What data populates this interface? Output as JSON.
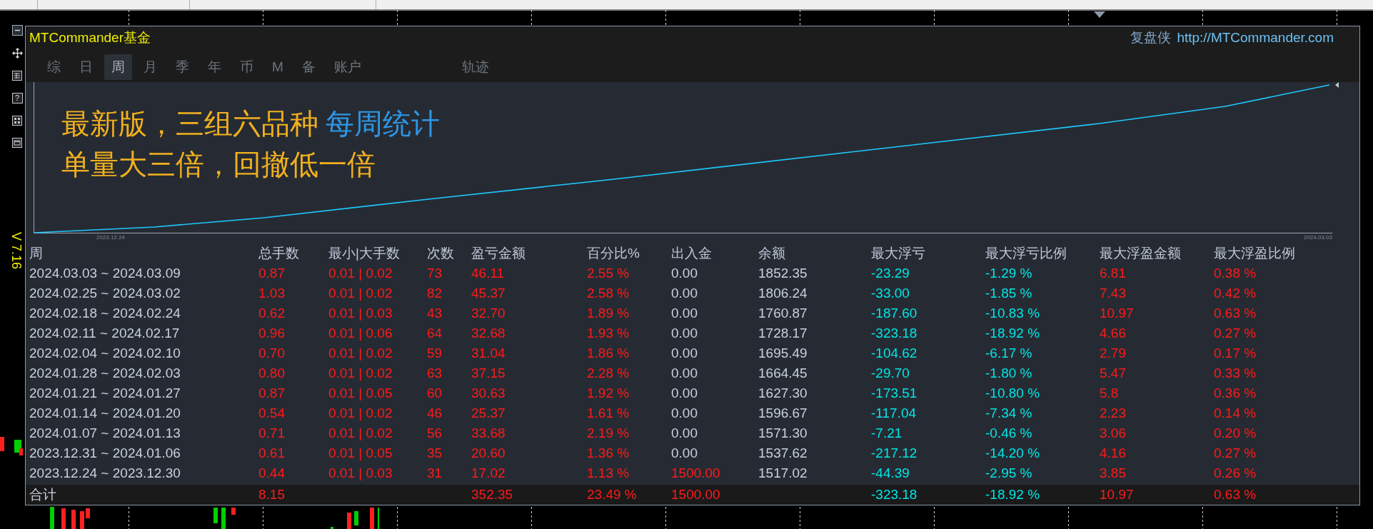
{
  "panel": {
    "title": "MTCommander基金",
    "brand": "复盘侠",
    "url": "http://MTCommander.com"
  },
  "side_toolbar": {
    "help": "?"
  },
  "version": "V 7.16",
  "tabs": [
    {
      "label": "综",
      "selected": false
    },
    {
      "label": "日",
      "selected": false
    },
    {
      "label": "周",
      "selected": true
    },
    {
      "label": "月",
      "selected": false
    },
    {
      "label": "季",
      "selected": false
    },
    {
      "label": "年",
      "selected": false
    },
    {
      "label": "币",
      "selected": false
    },
    {
      "label": "M",
      "selected": false
    },
    {
      "label": "备",
      "selected": false
    },
    {
      "label": "账户",
      "selected": false
    },
    {
      "label": "轨迹",
      "selected": false
    }
  ],
  "headline": {
    "line_1": "最新版，三组六品种",
    "tag": "每周统计",
    "line_2": "单量大三倍，回撤低一倍"
  },
  "chart": {
    "start_label": "2023.12.24",
    "end_label": "2024.03.03"
  },
  "table": {
    "columns": [
      {
        "label": "周",
        "kind": "label"
      },
      {
        "label": "总手数",
        "kind": "profit"
      },
      {
        "label": "最小|大手数",
        "kind": "profit"
      },
      {
        "label": "次数",
        "kind": "profit"
      },
      {
        "label": "盈亏金额",
        "kind": "profit"
      },
      {
        "label": "百分比%",
        "kind": "profit"
      },
      {
        "label": "出入金",
        "kind": "deposit"
      },
      {
        "label": "余额",
        "kind": "label"
      },
      {
        "label": "最大浮亏",
        "kind": "drawdown"
      },
      {
        "label": "最大浮亏比例",
        "kind": "drawdown"
      },
      {
        "label": "最大浮盈金额",
        "kind": "profit"
      },
      {
        "label": "最大浮盈比例",
        "kind": "profit"
      }
    ],
    "rows": [
      {
        "deposit": false,
        "cells": [
          "2024.03.03 ~ 2024.03.09",
          "0.87",
          "0.01 | 0.02",
          "73",
          "46.11",
          "2.55 %",
          "0.00",
          "1852.35",
          "-23.29",
          "-1.29 %",
          "6.81",
          "0.38 %"
        ]
      },
      {
        "deposit": false,
        "cells": [
          "2024.02.25 ~ 2024.03.02",
          "1.03",
          "0.01 | 0.02",
          "82",
          "45.37",
          "2.58 %",
          "0.00",
          "1806.24",
          "-33.00",
          "-1.85 %",
          "7.43",
          "0.42 %"
        ]
      },
      {
        "deposit": false,
        "cells": [
          "2024.02.18 ~ 2024.02.24",
          "0.62",
          "0.01 | 0.03",
          "43",
          "32.70",
          "1.89 %",
          "0.00",
          "1760.87",
          "-187.60",
          "-10.83 %",
          "10.97",
          "0.63 %"
        ]
      },
      {
        "deposit": false,
        "cells": [
          "2024.02.11 ~ 2024.02.17",
          "0.96",
          "0.01 | 0.06",
          "64",
          "32.68",
          "1.93 %",
          "0.00",
          "1728.17",
          "-323.18",
          "-18.92 %",
          "4.66",
          "0.27 %"
        ]
      },
      {
        "deposit": false,
        "cells": [
          "2024.02.04 ~ 2024.02.10",
          "0.70",
          "0.01 | 0.02",
          "59",
          "31.04",
          "1.86 %",
          "0.00",
          "1695.49",
          "-104.62",
          "-6.17 %",
          "2.79",
          "0.17 %"
        ]
      },
      {
        "deposit": false,
        "cells": [
          "2024.01.28 ~ 2024.02.03",
          "0.80",
          "0.01 | 0.02",
          "63",
          "37.15",
          "2.28 %",
          "0.00",
          "1664.45",
          "-29.70",
          "-1.80 %",
          "5.47",
          "0.33 %"
        ]
      },
      {
        "deposit": false,
        "cells": [
          "2024.01.21 ~ 2024.01.27",
          "0.87",
          "0.01 | 0.05",
          "60",
          "30.63",
          "1.92 %",
          "0.00",
          "1627.30",
          "-173.51",
          "-10.80 %",
          "5.8",
          "0.36 %"
        ]
      },
      {
        "deposit": false,
        "cells": [
          "2024.01.14 ~ 2024.01.20",
          "0.54",
          "0.01 | 0.02",
          "46",
          "25.37",
          "1.61 %",
          "0.00",
          "1596.67",
          "-117.04",
          "-7.34 %",
          "2.23",
          "0.14 %"
        ]
      },
      {
        "deposit": false,
        "cells": [
          "2024.01.07 ~ 2024.01.13",
          "0.71",
          "0.01 | 0.02",
          "56",
          "33.68",
          "2.19 %",
          "0.00",
          "1571.30",
          "-7.21",
          "-0.46 %",
          "3.06",
          "0.20 %"
        ]
      },
      {
        "deposit": false,
        "cells": [
          "2023.12.31 ~ 2024.01.06",
          "0.61",
          "0.01 | 0.05",
          "35",
          "20.60",
          "1.36 %",
          "0.00",
          "1537.62",
          "-217.12",
          "-14.20 %",
          "4.16",
          "0.27 %"
        ]
      },
      {
        "deposit": true,
        "cells": [
          "2023.12.24 ~ 2023.12.30",
          "0.44",
          "0.01 | 0.03",
          "31",
          "17.02",
          "1.13 %",
          "1500.00",
          "1517.02",
          "-44.39",
          "-2.95 %",
          "3.85",
          "0.26 %"
        ]
      }
    ],
    "total": {
      "deposit": true,
      "cells": [
        "合计",
        "8.15",
        null,
        null,
        "352.35",
        "23.49 %",
        "1500.00",
        null,
        "-323.18",
        "-18.92 %",
        "10.97",
        "0.63 %"
      ]
    }
  }
}
